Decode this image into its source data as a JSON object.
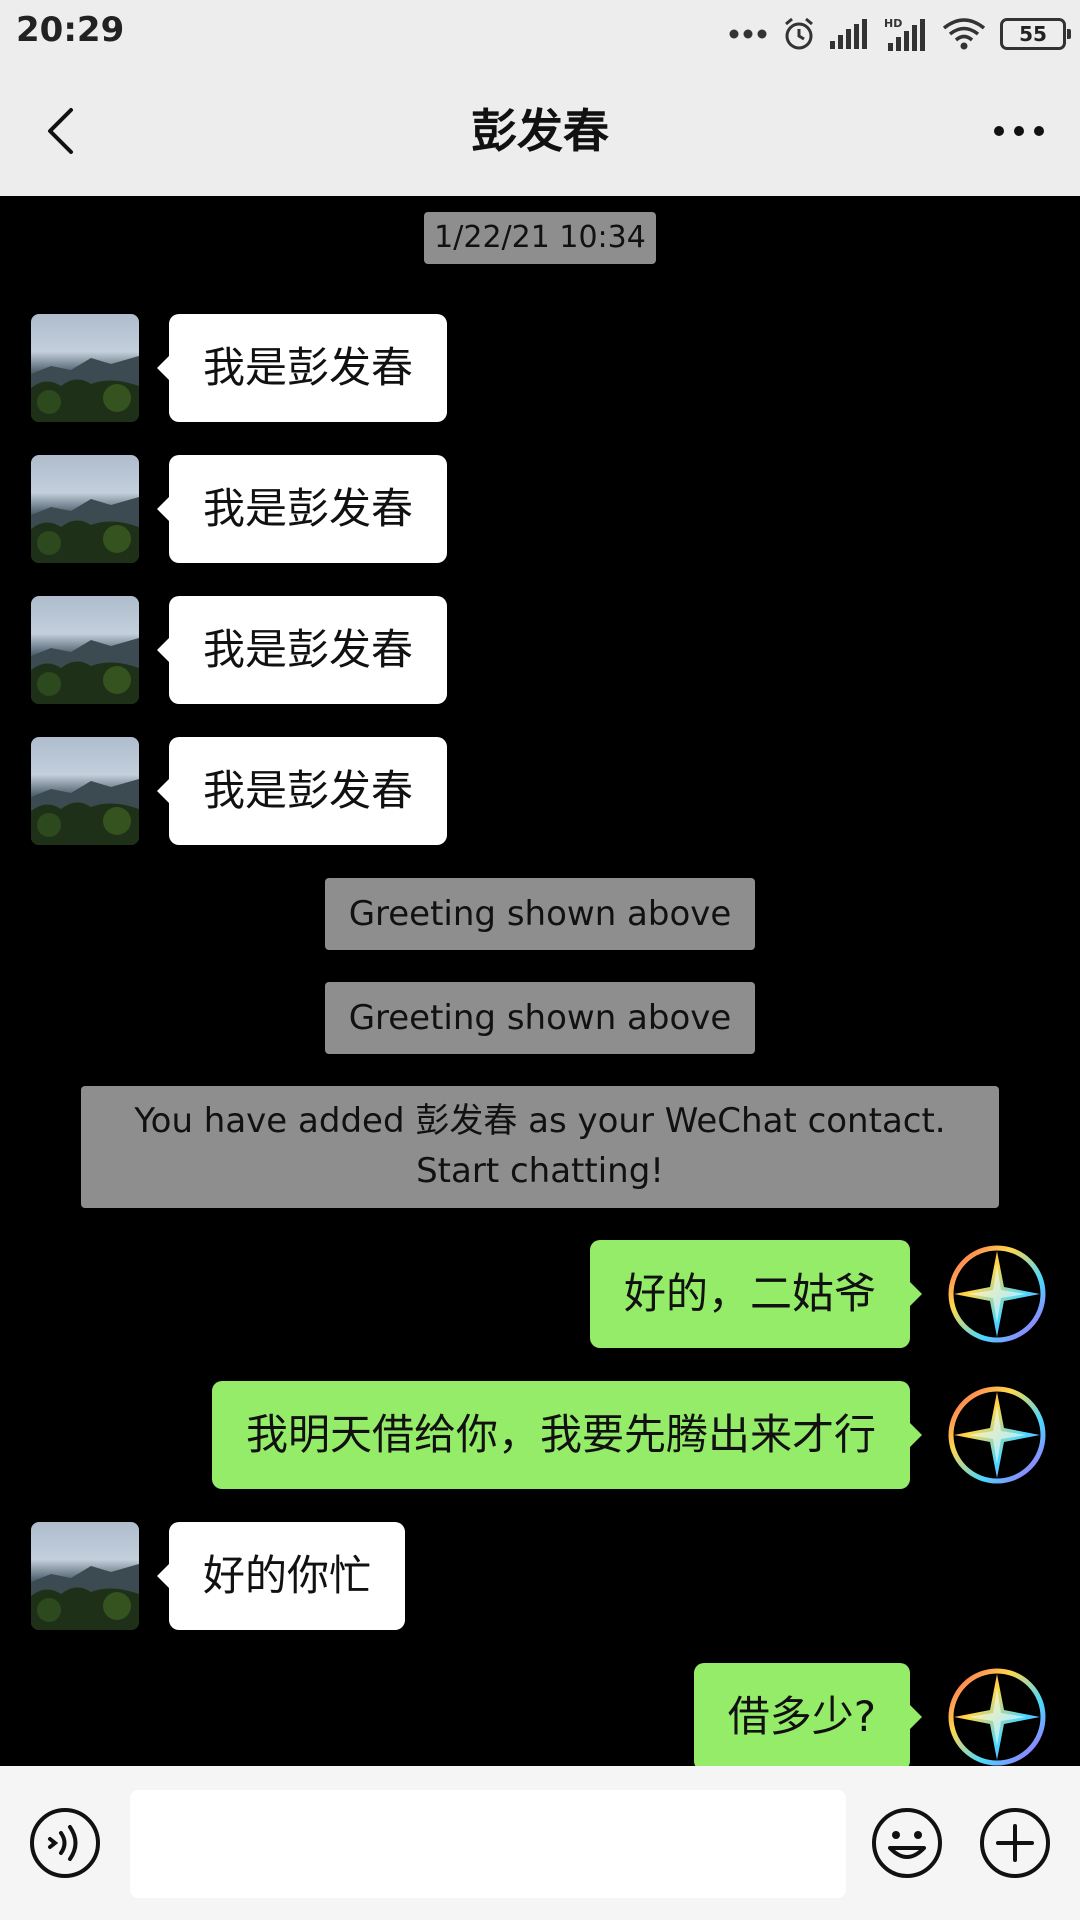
{
  "status_bar": {
    "time": "20:29",
    "battery": "55",
    "icons": [
      "more-dots-icon",
      "alarm-icon",
      "signal-icon",
      "hd-signal-icon",
      "wifi-icon",
      "battery-icon"
    ]
  },
  "header": {
    "title": "彭发春",
    "back_icon": "chevron-left-icon",
    "more_icon": "more-horizontal-icon"
  },
  "chat": {
    "timestamp": "1/22/21 10:34",
    "messages": [
      {
        "side": "left",
        "text": "我是彭发春"
      },
      {
        "side": "left",
        "text": "我是彭发春"
      },
      {
        "side": "left",
        "text": "我是彭发春"
      },
      {
        "side": "left",
        "text": "我是彭发春"
      }
    ],
    "system": [
      "Greeting shown above",
      "Greeting shown above",
      "You have added 彭发春 as your WeChat contact.",
      "Start chatting!"
    ],
    "after": [
      {
        "side": "right",
        "text": "好的，二姑爷"
      },
      {
        "side": "right",
        "text": "我明天借给你，我要先腾出来才行"
      },
      {
        "side": "left",
        "text": "好的你忙"
      },
      {
        "side": "right",
        "text": "借多少?"
      }
    ]
  },
  "input_bar": {
    "voice_icon": "voice-icon",
    "emoji_icon": "emoji-icon",
    "plus_icon": "plus-icon",
    "text_value": ""
  },
  "colors": {
    "background": "#000000",
    "bar": "#ededed",
    "bubble_received": "#ffffff",
    "bubble_sent": "#95ec69",
    "system_message": "#8e8e8e"
  }
}
